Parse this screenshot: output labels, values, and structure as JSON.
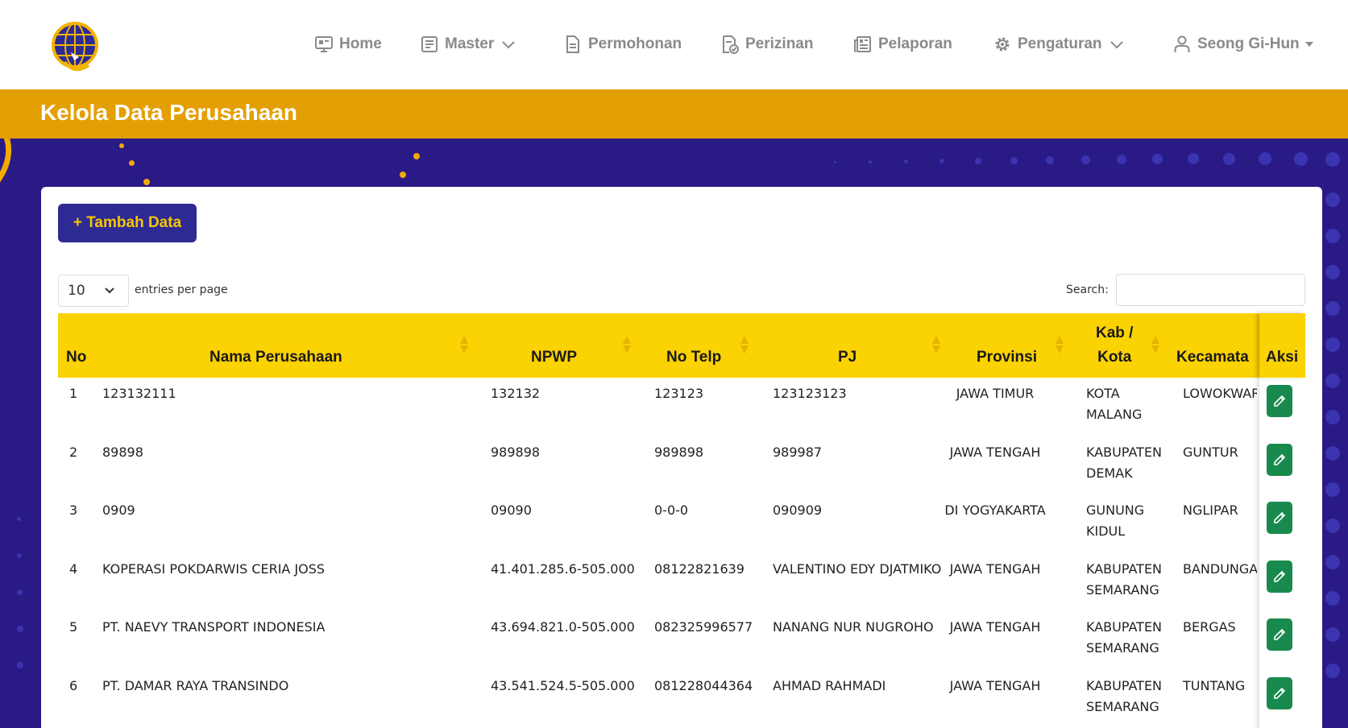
{
  "nav": {
    "home": "Home",
    "master": "Master",
    "permohonan": "Permohonan",
    "perizinan": "Perizinan",
    "pelaporan": "Pelaporan",
    "pengaturan": "Pengaturan",
    "user": "Seong Gi-Hun"
  },
  "page_title": "Kelola Data Perusahaan",
  "add_button": "+ Tambah Data",
  "entries": {
    "value": "10",
    "label": "entries per page"
  },
  "search": {
    "label": "Search:",
    "value": ""
  },
  "table": {
    "headers": {
      "no": "No",
      "nama": "Nama Perusahaan",
      "npwp": "NPWP",
      "telp": "No Telp",
      "pj": "PJ",
      "provinsi": "Provinsi",
      "kab_line1": "Kab /",
      "kab_line2": "Kota",
      "kecamatan": "Kecamata",
      "aksi": "Aksi"
    },
    "rows": [
      {
        "no": "1",
        "nama": "123132111",
        "npwp": "132132",
        "telp": "123123",
        "pj": "123123123",
        "provinsi": "JAWA TIMUR",
        "kab1": "KOTA",
        "kab2": "MALANG",
        "kecamatan": "LOWOKWAR"
      },
      {
        "no": "2",
        "nama": "89898",
        "npwp": "989898",
        "telp": "989898",
        "pj": "989987",
        "provinsi": "JAWA TENGAH",
        "kab1": "KABUPATEN",
        "kab2": "DEMAK",
        "kecamatan": "GUNTUR"
      },
      {
        "no": "3",
        "nama": "0909",
        "npwp": "09090",
        "telp": "0-0-0",
        "pj": "090909",
        "provinsi": "DI YOGYAKARTA",
        "kab1": "GUNUNG",
        "kab2": "KIDUL",
        "kecamatan": "NGLIPAR"
      },
      {
        "no": "4",
        "nama": "KOPERASI POKDARWIS CERIA JOSS",
        "npwp": "41.401.285.6-505.000",
        "telp": "08122821639",
        "pj": "VALENTINO EDY DJATMIKO",
        "provinsi": "JAWA TENGAH",
        "kab1": "KABUPATEN",
        "kab2": "SEMARANG",
        "kecamatan": "BANDUNGA"
      },
      {
        "no": "5",
        "nama": "PT. NAEVY TRANSPORT INDONESIA",
        "npwp": "43.694.821.0-505.000",
        "telp": "082325996577",
        "pj": "NANANG NUR NUGROHO",
        "provinsi": "JAWA TENGAH",
        "kab1": "KABUPATEN",
        "kab2": "SEMARANG",
        "kecamatan": "BERGAS"
      },
      {
        "no": "6",
        "nama": "PT. DAMAR RAYA TRANSINDO",
        "npwp": "43.541.524.5-505.000",
        "telp": "081228044364",
        "pj": "AHMAD RAHMADI",
        "provinsi": "JAWA TENGAH",
        "kab1": "KABUPATEN",
        "kab2": "SEMARANG",
        "kecamatan": "TUNTANG"
      }
    ]
  },
  "colors": {
    "primary": "#2a1a86",
    "accent": "#e39f03",
    "header_yellow": "#fbd202",
    "button_text": "#f7c600",
    "edit_green": "#198a4e"
  },
  "icons": [
    "logo",
    "monitor-icon",
    "list-icon",
    "document-icon",
    "document-check-icon",
    "newspaper-icon",
    "gear-icon",
    "chevron-down-icon",
    "user-icon",
    "caret-down-icon",
    "pencil-icon",
    "sort-icon"
  ]
}
